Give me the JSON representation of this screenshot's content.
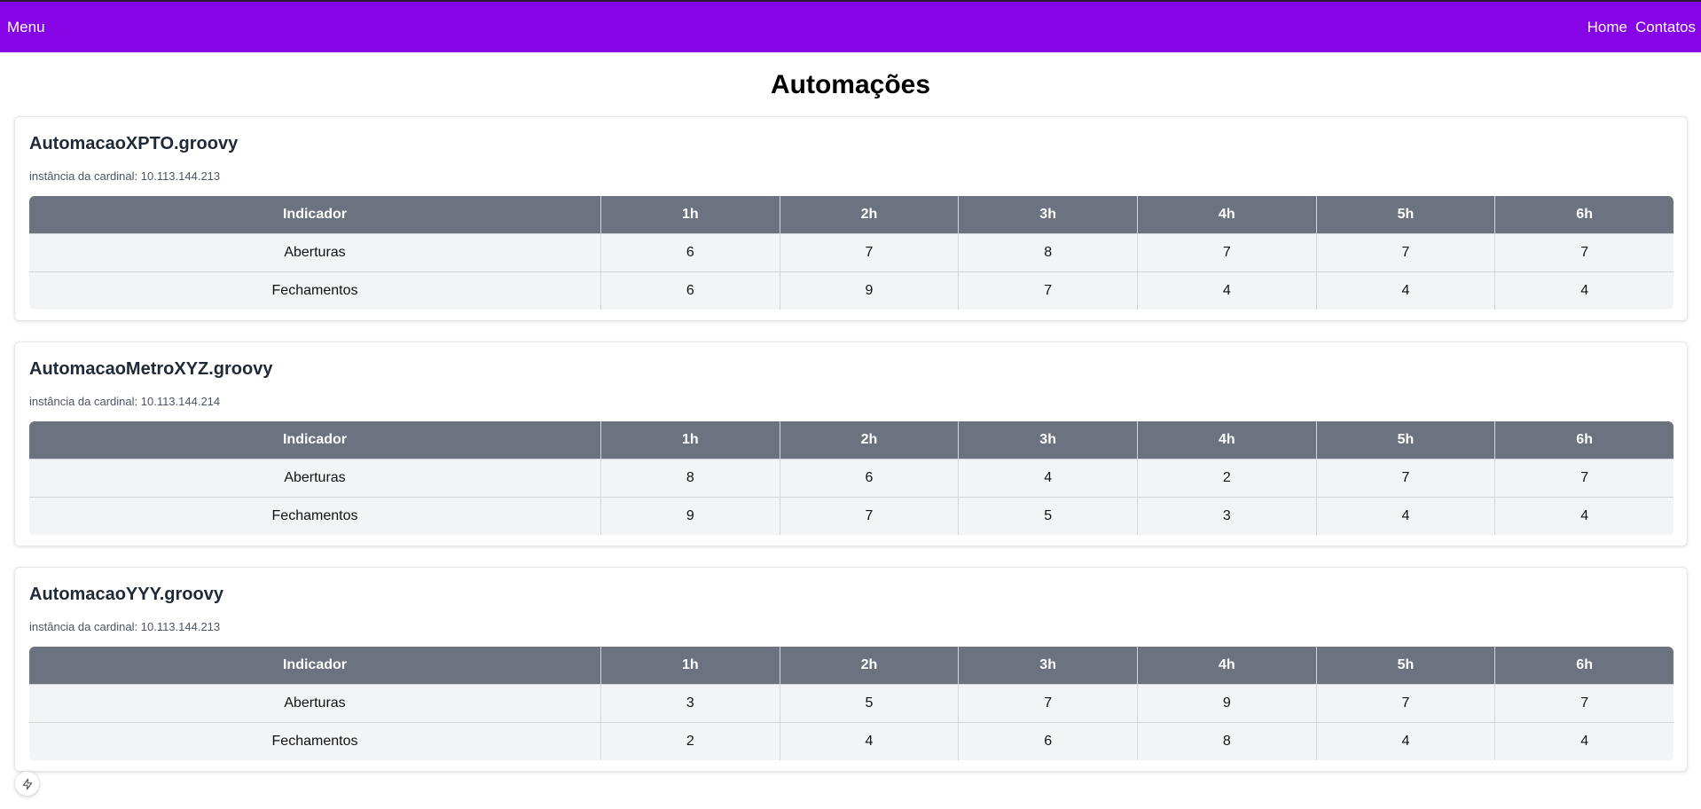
{
  "navbar": {
    "menu_label": "Menu",
    "links": [
      "Home",
      "Contatos"
    ],
    "background": "#8505e6"
  },
  "page": {
    "title": "Automações"
  },
  "table_headers": [
    "Indicador",
    "1h",
    "2h",
    "3h",
    "4h",
    "5h",
    "6h"
  ],
  "automations": [
    {
      "name": "AutomacaoXPTO.groovy",
      "instance": "instância da cardinal: 10.113.144.213",
      "rows": [
        [
          "Aberturas",
          "6",
          "7",
          "8",
          "7",
          "7",
          "7"
        ],
        [
          "Fechamentos",
          "6",
          "9",
          "7",
          "4",
          "4",
          "4"
        ]
      ]
    },
    {
      "name": "AutomacaoMetroXYZ.groovy",
      "instance": "instância da cardinal: 10.113.144.214",
      "rows": [
        [
          "Aberturas",
          "8",
          "6",
          "4",
          "2",
          "7",
          "7"
        ],
        [
          "Fechamentos",
          "9",
          "7",
          "5",
          "3",
          "4",
          "4"
        ]
      ]
    },
    {
      "name": "AutomacaoYYY.groovy",
      "instance": "instância da cardinal: 10.113.144.213",
      "rows": [
        [
          "Aberturas",
          "3",
          "5",
          "7",
          "9",
          "7",
          "7"
        ],
        [
          "Fechamentos",
          "2",
          "4",
          "6",
          "8",
          "4",
          "4"
        ]
      ]
    }
  ],
  "floating_button": {
    "icon": "lightning-bolt-icon"
  }
}
